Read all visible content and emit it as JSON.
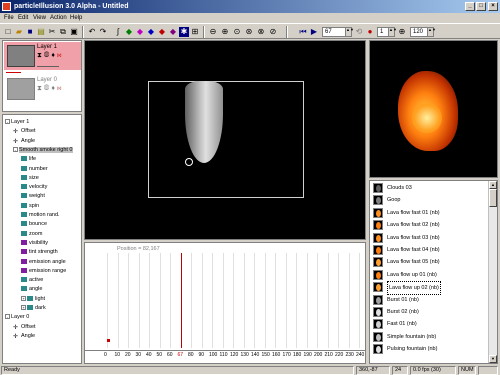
{
  "window": {
    "title": "particleIllusion 3.0 Alpha - Untitled",
    "min": "_",
    "max": "□",
    "close": "×"
  },
  "menu": [
    "File",
    "Edit",
    "View",
    "Action",
    "Help"
  ],
  "toolbar": {
    "frame_value": "67",
    "frame_end_value": "1",
    "zoom_value": "120"
  },
  "layers": [
    {
      "name": "Layer 1",
      "selected": true
    },
    {
      "name": "Layer 0",
      "selected": false
    }
  ],
  "tree": [
    {
      "label": "Layer 1",
      "indent": 0,
      "exp": "-"
    },
    {
      "label": "Offset",
      "indent": 1
    },
    {
      "label": "Angle",
      "indent": 1
    },
    {
      "label": "Smooth smoke right 0",
      "indent": 1,
      "exp": "-",
      "sel": true
    },
    {
      "label": "life",
      "indent": 2
    },
    {
      "label": "number",
      "indent": 2
    },
    {
      "label": "size",
      "indent": 2
    },
    {
      "label": "velocity",
      "indent": 2
    },
    {
      "label": "weight",
      "indent": 2
    },
    {
      "label": "spin",
      "indent": 2
    },
    {
      "label": "motion rand.",
      "indent": 2
    },
    {
      "label": "bounce",
      "indent": 2
    },
    {
      "label": "zoom",
      "indent": 2
    },
    {
      "label": "visibility",
      "indent": 2
    },
    {
      "label": "tint strength",
      "indent": 2
    },
    {
      "label": "emission angle",
      "indent": 2
    },
    {
      "label": "emission range",
      "indent": 2
    },
    {
      "label": "active",
      "indent": 2
    },
    {
      "label": "angle",
      "indent": 2
    },
    {
      "label": "light",
      "indent": 2,
      "exp": "+"
    },
    {
      "label": "dark",
      "indent": 2,
      "exp": "+"
    },
    {
      "label": "Layer 0",
      "indent": 0,
      "exp": "-"
    },
    {
      "label": "Offset",
      "indent": 1
    },
    {
      "label": "Angle",
      "indent": 1
    }
  ],
  "timeline": {
    "position_label": "Position = 82,167",
    "ticks": [
      "0",
      "10",
      "20",
      "30",
      "40",
      "50",
      "60",
      "67",
      "80",
      "90",
      "100",
      "110",
      "120",
      "130",
      "140",
      "150",
      "160",
      "170",
      "180",
      "190",
      "200",
      "210",
      "220",
      "230",
      "240"
    ]
  },
  "library": [
    {
      "name": "Clouds 03",
      "color": "#606060"
    },
    {
      "name": "Goop",
      "color": "#808080"
    },
    {
      "name": "Lava flow fast 01 (nb)",
      "color": "#ff9020"
    },
    {
      "name": "Lava flow fast 02 (nb)",
      "color": "#ff8010"
    },
    {
      "name": "Lava flow fast 03 (nb)",
      "color": "#ff9020"
    },
    {
      "name": "Lava flow fast 04 (nb)",
      "color": "#ff8010"
    },
    {
      "name": "Lava flow fast 05 (nb)",
      "color": "#ffa030"
    },
    {
      "name": "Lava flow up 01 (nb)",
      "color": "#ff8010"
    },
    {
      "name": "Lava flow up 02 (nb)",
      "color": "#ffa030",
      "sel": true
    },
    {
      "name": "Burst 01 (nb)",
      "color": "#a0a0a0"
    },
    {
      "name": "Burst 02 (nb)",
      "color": "#e0e0e0"
    },
    {
      "name": "Fast 01 (nb)",
      "color": "#d0d0d0"
    },
    {
      "name": "Simple fountain (nb)",
      "color": "#c0c0c0"
    },
    {
      "name": "Pulsing fountain (nb)",
      "color": "#e0e0e0"
    }
  ],
  "status": {
    "ready": "Ready",
    "coords": "360,-87",
    "frame": "24",
    "fps": "0.0 fps (30)",
    "num": "NUM"
  }
}
